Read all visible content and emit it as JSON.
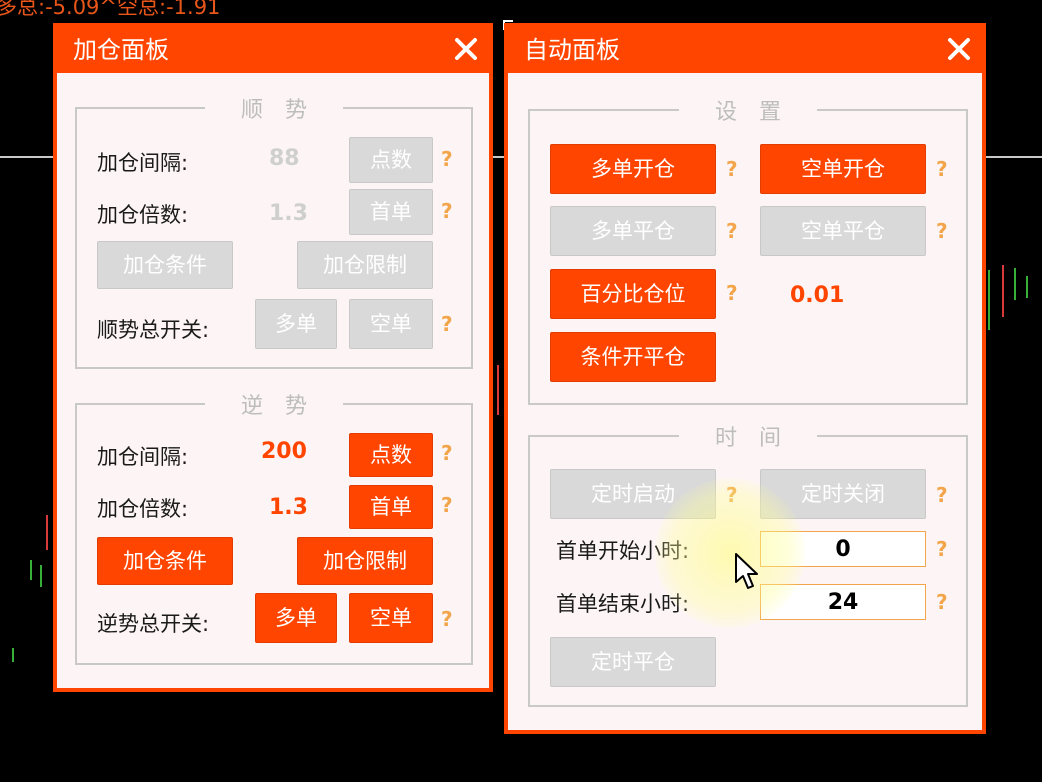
{
  "status_bar": {
    "text": "多总:-5.09^空总:-1.91"
  },
  "icons": {
    "close": "close-icon",
    "cursor": "mouse-pointer-icon"
  },
  "colors": {
    "accent": "#ff4500",
    "panel_background": "#fdf5f5",
    "disabled_button": "#d9d9d9",
    "help_mark": "#f2a54a",
    "chart_red": "#d83a3a",
    "chart_green": "#37b037"
  },
  "add_panel": {
    "title": "加仓面板",
    "trend": {
      "title": "顺势",
      "interval_label": "加仓间隔:",
      "interval_value": "88",
      "points_button": "点数",
      "multiplier_label": "加仓倍数:",
      "multiplier_value": "1.3",
      "first_order_button": "首单",
      "condition_button": "加仓条件",
      "limit_button": "加仓限制",
      "master_switch_label": "顺势总开关:",
      "long_button": "多单",
      "short_button": "空单",
      "help": "?"
    },
    "counter_trend": {
      "title": "逆势",
      "interval_label": "加仓间隔:",
      "interval_value": "200",
      "points_button": "点数",
      "multiplier_label": "加仓倍数:",
      "multiplier_value": "1.3",
      "first_order_button": "首单",
      "condition_button": "加仓条件",
      "limit_button": "加仓限制",
      "master_switch_label": "逆势总开关:",
      "long_button": "多单",
      "short_button": "空单",
      "help": "?"
    }
  },
  "auto_panel": {
    "title": "自动面板",
    "settings": {
      "title": "设置",
      "long_open_button": "多单开仓",
      "short_open_button": "空单开仓",
      "long_close_button": "多单平仓",
      "short_close_button": "空单平仓",
      "percent_position_button": "百分比仓位",
      "percent_value": "0.01",
      "conditional_button": "条件开平仓",
      "help": "?"
    },
    "time": {
      "title": "时间",
      "timer_start_button": "定时启动",
      "timer_stop_button": "定时关闭",
      "first_start_hour_label": "首单开始小时:",
      "first_start_hour_value": "0",
      "first_end_hour_label": "首单结束小时:",
      "first_end_hour_value": "24",
      "timed_close_button": "定时平仓",
      "help": "?"
    }
  }
}
